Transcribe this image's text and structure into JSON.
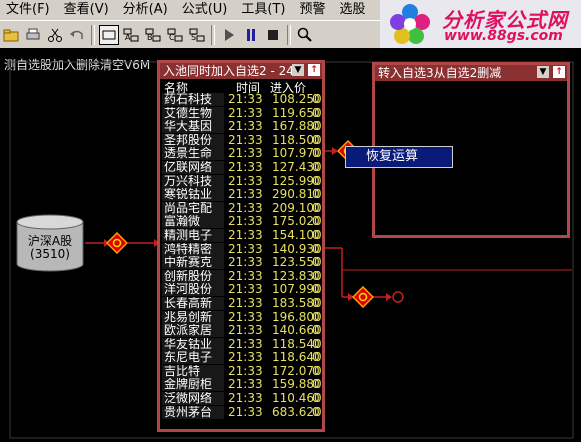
{
  "menu": [
    "文件(F)",
    "查看(V)",
    "分析(A)",
    "公式(U)",
    "工具(T)",
    "预警",
    "选股"
  ],
  "logo": {
    "title": "分析家公式网",
    "url": "www.88gs.com"
  },
  "caption": "测自选股加入删除清空V6M",
  "source": {
    "line1": "沪深A股",
    "line2": "(3510)"
  },
  "panel1": {
    "title": "入池同时加入自选2 - 24",
    "headers": {
      "name": "名称",
      "time": "时间",
      "price": "进入价"
    },
    "rows": [
      {
        "name": "药石科技",
        "time": "21:33",
        "price": "108.250",
        "extra": "0"
      },
      {
        "name": "艾德生物",
        "time": "21:33",
        "price": "119.650",
        "extra": "0"
      },
      {
        "name": "华大基因",
        "time": "21:33",
        "price": "167.880",
        "extra": "0"
      },
      {
        "name": "圣邦股份",
        "time": "21:33",
        "price": "118.500",
        "extra": "0"
      },
      {
        "name": "透景生命",
        "time": "21:33",
        "price": "107.970",
        "extra": "0"
      },
      {
        "name": "亿联网络",
        "time": "21:33",
        "price": "127.430",
        "extra": "0"
      },
      {
        "name": "万兴科技",
        "time": "21:33",
        "price": "125.990",
        "extra": "0"
      },
      {
        "name": "寒锐钴业",
        "time": "21:33",
        "price": "290.810",
        "extra": "0"
      },
      {
        "name": "尚品宅配",
        "time": "21:33",
        "price": "209.100",
        "extra": "0"
      },
      {
        "name": "富瀚微",
        "time": "21:33",
        "price": "175.020",
        "extra": "0"
      },
      {
        "name": "精测电子",
        "time": "21:33",
        "price": "154.100",
        "extra": "0"
      },
      {
        "name": "鸿特精密",
        "time": "21:33",
        "price": "140.930",
        "extra": "0"
      },
      {
        "name": "中新赛克",
        "time": "21:33",
        "price": "123.550",
        "extra": "0"
      },
      {
        "name": "创新股份",
        "time": "21:33",
        "price": "123.830",
        "extra": "0"
      },
      {
        "name": "洋河股份",
        "time": "21:33",
        "price": "107.990",
        "extra": "0"
      },
      {
        "name": "长春高新",
        "time": "21:33",
        "price": "183.580",
        "extra": "0"
      },
      {
        "name": "兆易创新",
        "time": "21:33",
        "price": "196.800",
        "extra": "0"
      },
      {
        "name": "欧派家居",
        "time": "21:33",
        "price": "140.660",
        "extra": "0"
      },
      {
        "name": "华友钴业",
        "time": "21:33",
        "price": "118.540",
        "extra": "0"
      },
      {
        "name": "东尼电子",
        "time": "21:33",
        "price": "118.640",
        "extra": "0"
      },
      {
        "name": "吉比特",
        "time": "21:33",
        "price": "172.070",
        "extra": "0"
      },
      {
        "name": "金牌厨柜",
        "time": "21:33",
        "price": "159.880",
        "extra": "0"
      },
      {
        "name": "泛微网络",
        "time": "21:33",
        "price": "110.460",
        "extra": "0"
      },
      {
        "name": "贵州茅台",
        "time": "21:33",
        "price": "683.620",
        "extra": "0"
      }
    ]
  },
  "panel2": {
    "title": "转入自选3从自选2删减"
  },
  "context_menu": {
    "item": "恢复运算"
  },
  "colors": {
    "panel_border": "#b04848",
    "panel_title": "#8a3030",
    "value_yellow": "#e8e060",
    "wire": "#c02020",
    "node": "#e00000"
  }
}
